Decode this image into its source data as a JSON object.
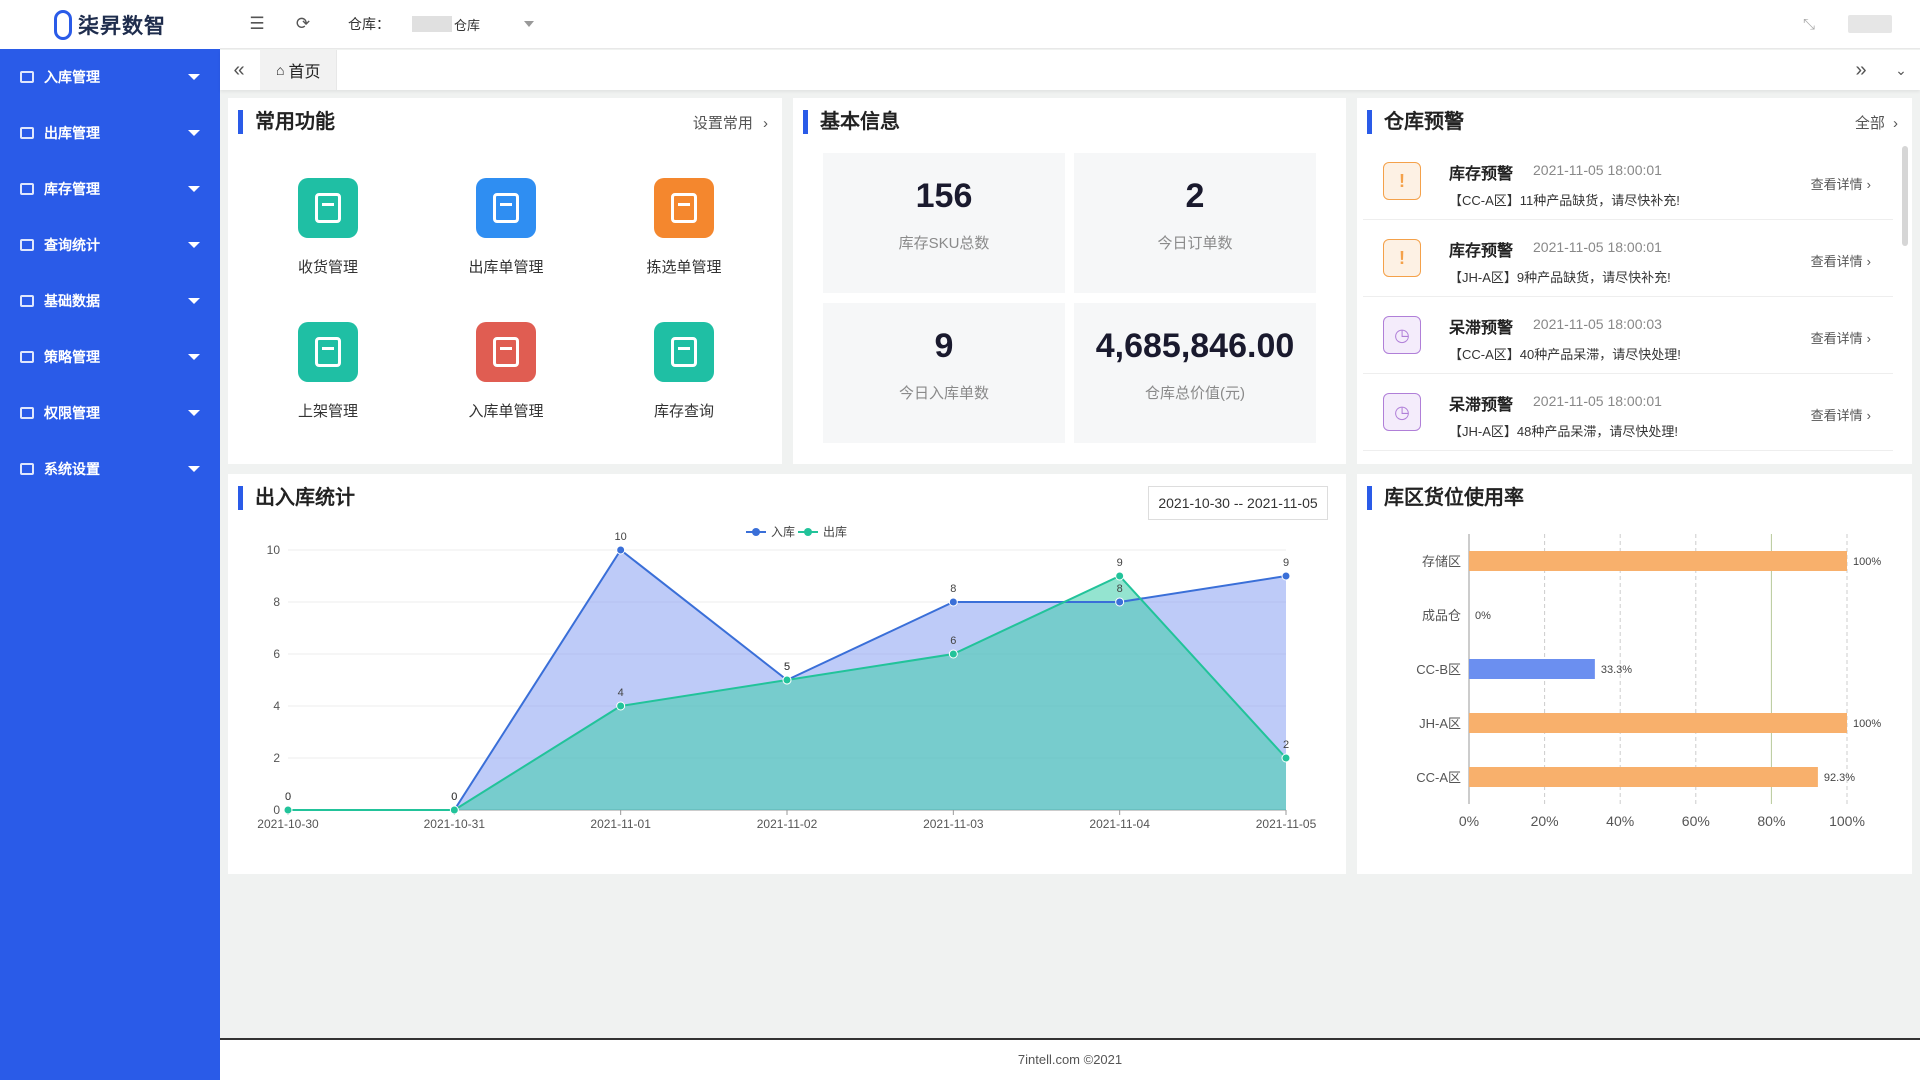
{
  "brand": {
    "name": "柒昇数智"
  },
  "sidebar": {
    "items": [
      {
        "label": "入库管理",
        "icon": "inbound-icon"
      },
      {
        "label": "出库管理",
        "icon": "outbound-icon"
      },
      {
        "label": "库存管理",
        "icon": "inventory-icon"
      },
      {
        "label": "查询统计",
        "icon": "chart-icon"
      },
      {
        "label": "基础数据",
        "icon": "data-icon"
      },
      {
        "label": "策略管理",
        "icon": "strategy-icon"
      },
      {
        "label": "权限管理",
        "icon": "user-icon"
      },
      {
        "label": "系统设置",
        "icon": "settings-icon"
      }
    ]
  },
  "topbar": {
    "warehouse_label": "仓库：",
    "warehouse_value": "仓库"
  },
  "tabs": [
    {
      "label": "首页"
    }
  ],
  "common": {
    "title": "常用功能",
    "link": "设置常用",
    "items": [
      {
        "label": "收货管理",
        "color": "#1fbfa4"
      },
      {
        "label": "出库单管理",
        "color": "#2f8ef2"
      },
      {
        "label": "拣选单管理",
        "color": "#f4872e"
      },
      {
        "label": "上架管理",
        "color": "#1fbfa4"
      },
      {
        "label": "入库单管理",
        "color": "#e05d52"
      },
      {
        "label": "库存查询",
        "color": "#1fbfa4"
      }
    ]
  },
  "basic": {
    "title": "基本信息",
    "stats": [
      {
        "value": "156",
        "label": "库存SKU总数"
      },
      {
        "value": "2",
        "label": "今日订单数"
      },
      {
        "value": "9",
        "label": "今日入库单数"
      },
      {
        "value": "4,685,846.00",
        "label": "仓库总价值(元)"
      }
    ]
  },
  "alerts": {
    "title": "仓库预警",
    "all": "全部",
    "view": "查看详情",
    "items": [
      {
        "type": "库存预警",
        "time": "2021-11-05 18:00:01",
        "msg": "【CC-A区】11种产品缺货，请尽快补充!",
        "icon": "!",
        "color": "#f4a14a",
        "bg": "#fdf1e4"
      },
      {
        "type": "库存预警",
        "time": "2021-11-05 18:00:01",
        "msg": "【JH-A区】9种产品缺货，请尽快补充!",
        "icon": "!",
        "color": "#f4a14a",
        "bg": "#fdf1e4"
      },
      {
        "type": "呆滞预警",
        "time": "2021-11-05 18:00:03",
        "msg": "【CC-A区】40种产品呆滞，请尽快处理!",
        "icon": "◷",
        "color": "#b07fd8",
        "bg": "#f4ecfb"
      },
      {
        "type": "呆滞预警",
        "time": "2021-11-05 18:00:01",
        "msg": "【JH-A区】48种产品呆滞，请尽快处理!",
        "icon": "◷",
        "color": "#b07fd8",
        "bg": "#f4ecfb"
      }
    ]
  },
  "inout": {
    "title": "出入库统计",
    "date_range": "2021-10-30 -- 2021-11-05"
  },
  "usage": {
    "title": "库区货位使用率"
  },
  "footer": {
    "text": "7intell.com ©2021"
  },
  "chart_data": [
    {
      "type": "area",
      "x": [
        "2021-10-30",
        "2021-10-31",
        "2021-11-01",
        "2021-11-02",
        "2021-11-03",
        "2021-11-04",
        "2021-11-05"
      ],
      "series": [
        {
          "name": "入库",
          "values": [
            0,
            0,
            10,
            5,
            8,
            8,
            9
          ],
          "color": "#3a6fd8"
        },
        {
          "name": "出库",
          "values": [
            0,
            0,
            4,
            5,
            6,
            9,
            2
          ],
          "color": "#22c39a"
        }
      ],
      "ylim": [
        0,
        10
      ],
      "yticks": [
        0,
        2,
        4,
        6,
        8,
        10
      ],
      "legend": "top-center",
      "grid": true
    },
    {
      "type": "bar",
      "orientation": "horizontal",
      "categories": [
        "存储区",
        "成品仓",
        "CC-B区",
        "JH-A区",
        "CC-A区"
      ],
      "values": [
        100,
        0,
        33.3,
        100,
        92.3
      ],
      "labels": [
        "100%",
        "0%",
        "33.3%",
        "100%",
        "92.3%"
      ],
      "colors": [
        "#f8b06c",
        "#f8b06c",
        "#6b8ff0",
        "#f8b06c",
        "#f8b06c"
      ],
      "xlim": [
        0,
        100
      ],
      "xticks": [
        "0%",
        "20%",
        "40%",
        "60%",
        "80%",
        "100%"
      ],
      "grid": true
    }
  ]
}
